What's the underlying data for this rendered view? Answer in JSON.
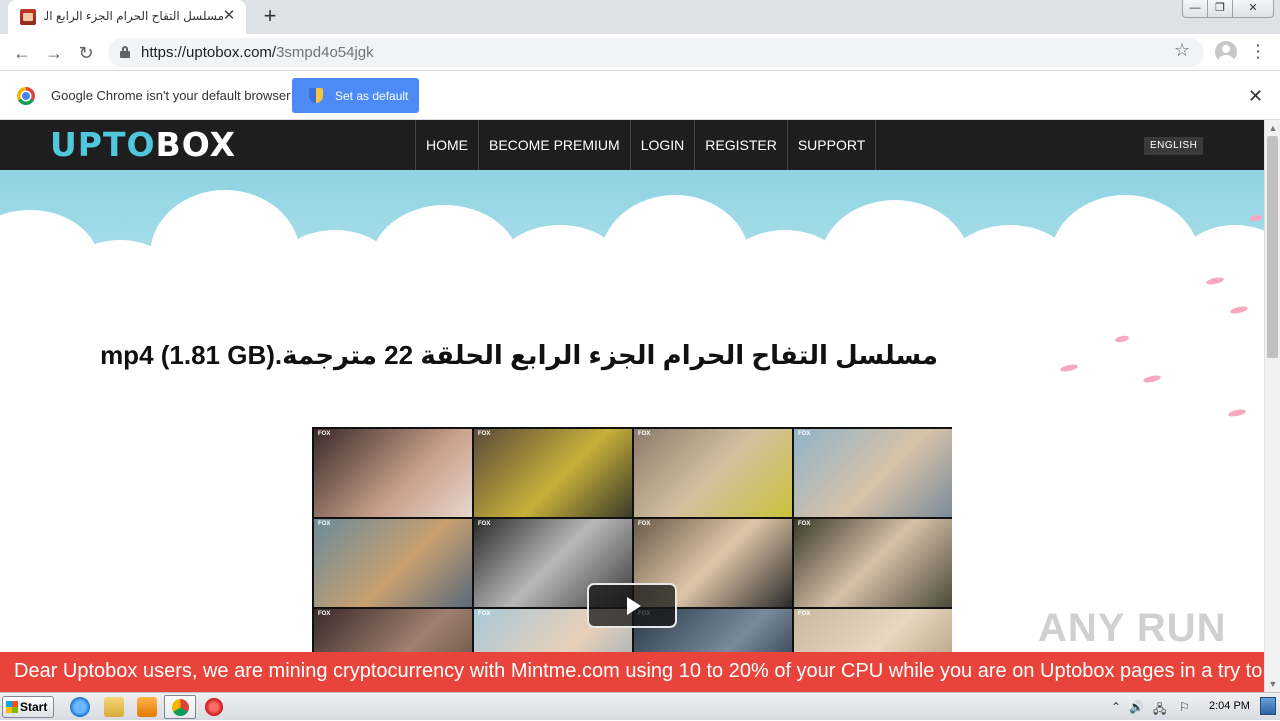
{
  "browser": {
    "tab_title": "مسلسل التفاح الحرام الجزء الرابع الحلقة 22 مترجمة",
    "tab_close": "✕",
    "new_tab": "+",
    "url_host": "https://uptobox.com/",
    "url_path": "3smpd4o54jgk",
    "back_icon": "←",
    "forward_icon": "→",
    "reload_icon": "↻",
    "bookmark_star": "☆",
    "menu_icon": "⋮",
    "window_min": "—",
    "window_max": "❐",
    "window_close": "✕"
  },
  "infobar": {
    "message": "Google Chrome isn't your default browser",
    "button_label": "Set as default",
    "close": "✕"
  },
  "site": {
    "logo_part1": "UPTO",
    "logo_part2": "BOX",
    "nav": [
      "HOME",
      "BECOME PREMIUM",
      "LOGIN",
      "REGISTER",
      "SUPPORT"
    ],
    "language": "ENGLISH",
    "file_title": "مسلسل التفاح الحرام الجزء الرابع الحلقة 22 مترجمة.mp4 (1.81 GB)",
    "thumb_tag": "FOX",
    "banner": "Dear Uptobox users, we are mining cryptocurrency with Mintme.com using 10 to 20% of your CPU while you are on Uptobox pages in a try to"
  },
  "watermark": "ANY RUN",
  "taskbar": {
    "start_label": "Start",
    "clock": "2:04 PM",
    "tray_icons": [
      "⌃",
      "🔊",
      "🖧",
      "⚐"
    ]
  },
  "colors": {
    "brand_cyan": "#4fc8dd",
    "banner_red": "#e8443b",
    "chrome_blue": "#4c8bf5",
    "sky": "#8fd3e2"
  }
}
